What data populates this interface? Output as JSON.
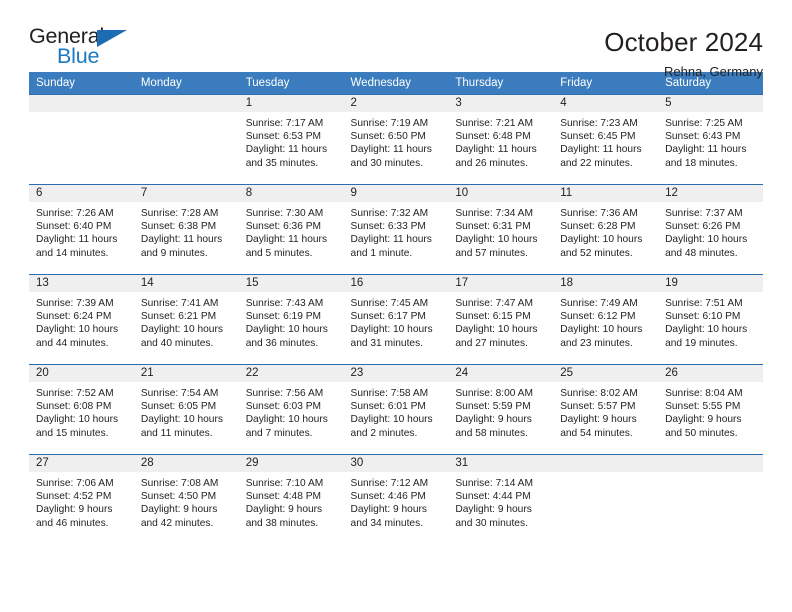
{
  "brand": {
    "name_part1": "General",
    "name_part2": "Blue",
    "triangle_color": "#1c6cb3",
    "blue_color": "#1c79c0"
  },
  "header": {
    "title": "October 2024",
    "subtitle": "Rehna, Germany",
    "accent_color": "#3a7cbe",
    "band_color": "#efefef"
  },
  "weekdays": [
    "Sunday",
    "Monday",
    "Tuesday",
    "Wednesday",
    "Thursday",
    "Friday",
    "Saturday"
  ],
  "labels": {
    "sunrise": "Sunrise:",
    "sunset": "Sunset:",
    "daylight": "Daylight:"
  },
  "weeks": [
    [
      {
        "day": "",
        "empty": true
      },
      {
        "day": "",
        "empty": true
      },
      {
        "day": "1",
        "sunrise": "Sunrise: 7:17 AM",
        "sunset": "Sunset: 6:53 PM",
        "daylight_1": "Daylight: 11 hours",
        "daylight_2": "and 35 minutes."
      },
      {
        "day": "2",
        "sunrise": "Sunrise: 7:19 AM",
        "sunset": "Sunset: 6:50 PM",
        "daylight_1": "Daylight: 11 hours",
        "daylight_2": "and 30 minutes."
      },
      {
        "day": "3",
        "sunrise": "Sunrise: 7:21 AM",
        "sunset": "Sunset: 6:48 PM",
        "daylight_1": "Daylight: 11 hours",
        "daylight_2": "and 26 minutes."
      },
      {
        "day": "4",
        "sunrise": "Sunrise: 7:23 AM",
        "sunset": "Sunset: 6:45 PM",
        "daylight_1": "Daylight: 11 hours",
        "daylight_2": "and 22 minutes."
      },
      {
        "day": "5",
        "sunrise": "Sunrise: 7:25 AM",
        "sunset": "Sunset: 6:43 PM",
        "daylight_1": "Daylight: 11 hours",
        "daylight_2": "and 18 minutes."
      }
    ],
    [
      {
        "day": "6",
        "sunrise": "Sunrise: 7:26 AM",
        "sunset": "Sunset: 6:40 PM",
        "daylight_1": "Daylight: 11 hours",
        "daylight_2": "and 14 minutes."
      },
      {
        "day": "7",
        "sunrise": "Sunrise: 7:28 AM",
        "sunset": "Sunset: 6:38 PM",
        "daylight_1": "Daylight: 11 hours",
        "daylight_2": "and 9 minutes."
      },
      {
        "day": "8",
        "sunrise": "Sunrise: 7:30 AM",
        "sunset": "Sunset: 6:36 PM",
        "daylight_1": "Daylight: 11 hours",
        "daylight_2": "and 5 minutes."
      },
      {
        "day": "9",
        "sunrise": "Sunrise: 7:32 AM",
        "sunset": "Sunset: 6:33 PM",
        "daylight_1": "Daylight: 11 hours",
        "daylight_2": "and 1 minute."
      },
      {
        "day": "10",
        "sunrise": "Sunrise: 7:34 AM",
        "sunset": "Sunset: 6:31 PM",
        "daylight_1": "Daylight: 10 hours",
        "daylight_2": "and 57 minutes."
      },
      {
        "day": "11",
        "sunrise": "Sunrise: 7:36 AM",
        "sunset": "Sunset: 6:28 PM",
        "daylight_1": "Daylight: 10 hours",
        "daylight_2": "and 52 minutes."
      },
      {
        "day": "12",
        "sunrise": "Sunrise: 7:37 AM",
        "sunset": "Sunset: 6:26 PM",
        "daylight_1": "Daylight: 10 hours",
        "daylight_2": "and 48 minutes."
      }
    ],
    [
      {
        "day": "13",
        "sunrise": "Sunrise: 7:39 AM",
        "sunset": "Sunset: 6:24 PM",
        "daylight_1": "Daylight: 10 hours",
        "daylight_2": "and 44 minutes."
      },
      {
        "day": "14",
        "sunrise": "Sunrise: 7:41 AM",
        "sunset": "Sunset: 6:21 PM",
        "daylight_1": "Daylight: 10 hours",
        "daylight_2": "and 40 minutes."
      },
      {
        "day": "15",
        "sunrise": "Sunrise: 7:43 AM",
        "sunset": "Sunset: 6:19 PM",
        "daylight_1": "Daylight: 10 hours",
        "daylight_2": "and 36 minutes."
      },
      {
        "day": "16",
        "sunrise": "Sunrise: 7:45 AM",
        "sunset": "Sunset: 6:17 PM",
        "daylight_1": "Daylight: 10 hours",
        "daylight_2": "and 31 minutes."
      },
      {
        "day": "17",
        "sunrise": "Sunrise: 7:47 AM",
        "sunset": "Sunset: 6:15 PM",
        "daylight_1": "Daylight: 10 hours",
        "daylight_2": "and 27 minutes."
      },
      {
        "day": "18",
        "sunrise": "Sunrise: 7:49 AM",
        "sunset": "Sunset: 6:12 PM",
        "daylight_1": "Daylight: 10 hours",
        "daylight_2": "and 23 minutes."
      },
      {
        "day": "19",
        "sunrise": "Sunrise: 7:51 AM",
        "sunset": "Sunset: 6:10 PM",
        "daylight_1": "Daylight: 10 hours",
        "daylight_2": "and 19 minutes."
      }
    ],
    [
      {
        "day": "20",
        "sunrise": "Sunrise: 7:52 AM",
        "sunset": "Sunset: 6:08 PM",
        "daylight_1": "Daylight: 10 hours",
        "daylight_2": "and 15 minutes."
      },
      {
        "day": "21",
        "sunrise": "Sunrise: 7:54 AM",
        "sunset": "Sunset: 6:05 PM",
        "daylight_1": "Daylight: 10 hours",
        "daylight_2": "and 11 minutes."
      },
      {
        "day": "22",
        "sunrise": "Sunrise: 7:56 AM",
        "sunset": "Sunset: 6:03 PM",
        "daylight_1": "Daylight: 10 hours",
        "daylight_2": "and 7 minutes."
      },
      {
        "day": "23",
        "sunrise": "Sunrise: 7:58 AM",
        "sunset": "Sunset: 6:01 PM",
        "daylight_1": "Daylight: 10 hours",
        "daylight_2": "and 2 minutes."
      },
      {
        "day": "24",
        "sunrise": "Sunrise: 8:00 AM",
        "sunset": "Sunset: 5:59 PM",
        "daylight_1": "Daylight: 9 hours",
        "daylight_2": "and 58 minutes."
      },
      {
        "day": "25",
        "sunrise": "Sunrise: 8:02 AM",
        "sunset": "Sunset: 5:57 PM",
        "daylight_1": "Daylight: 9 hours",
        "daylight_2": "and 54 minutes."
      },
      {
        "day": "26",
        "sunrise": "Sunrise: 8:04 AM",
        "sunset": "Sunset: 5:55 PM",
        "daylight_1": "Daylight: 9 hours",
        "daylight_2": "and 50 minutes."
      }
    ],
    [
      {
        "day": "27",
        "sunrise": "Sunrise: 7:06 AM",
        "sunset": "Sunset: 4:52 PM",
        "daylight_1": "Daylight: 9 hours",
        "daylight_2": "and 46 minutes."
      },
      {
        "day": "28",
        "sunrise": "Sunrise: 7:08 AM",
        "sunset": "Sunset: 4:50 PM",
        "daylight_1": "Daylight: 9 hours",
        "daylight_2": "and 42 minutes."
      },
      {
        "day": "29",
        "sunrise": "Sunrise: 7:10 AM",
        "sunset": "Sunset: 4:48 PM",
        "daylight_1": "Daylight: 9 hours",
        "daylight_2": "and 38 minutes."
      },
      {
        "day": "30",
        "sunrise": "Sunrise: 7:12 AM",
        "sunset": "Sunset: 4:46 PM",
        "daylight_1": "Daylight: 9 hours",
        "daylight_2": "and 34 minutes."
      },
      {
        "day": "31",
        "sunrise": "Sunrise: 7:14 AM",
        "sunset": "Sunset: 4:44 PM",
        "daylight_1": "Daylight: 9 hours",
        "daylight_2": "and 30 minutes."
      },
      {
        "day": "",
        "empty": true
      },
      {
        "day": "",
        "empty": true
      }
    ]
  ]
}
